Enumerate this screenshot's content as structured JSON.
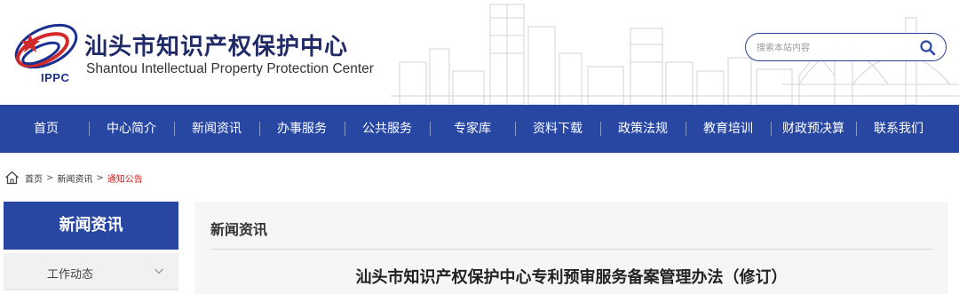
{
  "header": {
    "title_cn": "汕头市知识产权保护中心",
    "title_en": "Shantou Intellectual Property Protection Center",
    "logo_text": "IPPC",
    "brand_color": "#2747a3"
  },
  "search": {
    "placeholder": "搜索本站内容",
    "icon": "search-icon"
  },
  "nav": {
    "items": [
      {
        "label": "首页"
      },
      {
        "label": "中心简介"
      },
      {
        "label": "新闻资讯"
      },
      {
        "label": "办事服务"
      },
      {
        "label": "公共服务"
      },
      {
        "label": "专家库"
      },
      {
        "label": "资料下载"
      },
      {
        "label": "政策法规"
      },
      {
        "label": "教育培训"
      },
      {
        "label": "财政预决算"
      },
      {
        "label": "联系我们"
      }
    ]
  },
  "breadcrumb": {
    "icon": "home-icon",
    "items": [
      "首页",
      "新闻资讯",
      "通知公告"
    ],
    "separator": ">"
  },
  "sidebar": {
    "heading": "新闻资讯",
    "items": [
      {
        "label": "工作动态",
        "icon": "chevron-down-icon"
      }
    ]
  },
  "main": {
    "section_title": "新闻资讯",
    "article_title": "汕头市知识产权保护中心专利预审服务备案管理办法（修订）"
  }
}
